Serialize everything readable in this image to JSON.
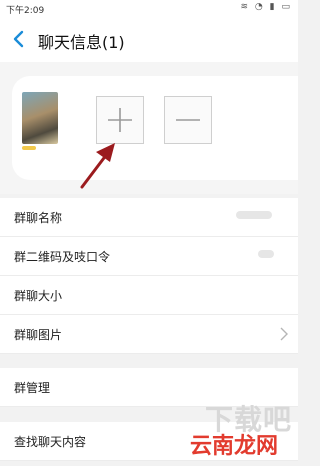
{
  "status_bar": {
    "time": "下午2:09",
    "icons": [
      "wifi-icon",
      "alarm-icon",
      "signal-icon",
      "battery-icon"
    ]
  },
  "header": {
    "title": "聊天信息(1)"
  },
  "members": {
    "add_label": "+",
    "remove_label": "−"
  },
  "settings": {
    "items": [
      {
        "label": "群聊名称"
      },
      {
        "label": "群二维码及吱口令"
      },
      {
        "label": "群聊大小"
      },
      {
        "label": "群聊图片"
      },
      {
        "label": "群管理"
      },
      {
        "label": "查找聊天内容"
      }
    ]
  },
  "watermark": {
    "top": "下载吧",
    "main": "云南龙网"
  },
  "colors": {
    "accent": "#1a8cd8",
    "arrow": "#9b1b1e"
  }
}
